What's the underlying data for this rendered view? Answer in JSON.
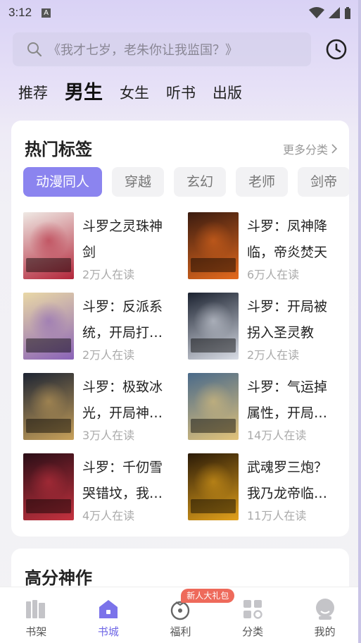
{
  "status_bar": {
    "time": "3:12",
    "app_badge": "A"
  },
  "search": {
    "placeholder": "《我才七岁，老朱你让我监国？》"
  },
  "channels": [
    {
      "label": "推荐",
      "active": false
    },
    {
      "label": "男生",
      "active": true
    },
    {
      "label": "女生",
      "active": false
    },
    {
      "label": "听书",
      "active": false
    },
    {
      "label": "出版",
      "active": false
    }
  ],
  "hot_tags": {
    "title": "热门标签",
    "more_label": "更多分类",
    "tags": [
      "动漫同人",
      "穿越",
      "玄幻",
      "老师",
      "剑帝"
    ],
    "active_tag": "动漫同人"
  },
  "books": [
    {
      "title": "斗罗之灵珠神剑",
      "readers": "2万人在读",
      "cover_colors": [
        "#efe9e4",
        "#b3263a"
      ]
    },
    {
      "title": "斗罗：凤神降临，帝炎焚天",
      "readers": "6万人在读",
      "cover_colors": [
        "#3a1b10",
        "#e56a1d"
      ]
    },
    {
      "title": "斗罗：反派系统，开局打…",
      "readers": "2万人在读",
      "cover_colors": [
        "#e9d8a6",
        "#8a63b8"
      ]
    },
    {
      "title": "斗罗：开局被拐入圣灵教",
      "readers": "2万人在读",
      "cover_colors": [
        "#1b2230",
        "#d9dde6"
      ]
    },
    {
      "title": "斗罗：极致冰光，开局神…",
      "readers": "3万人在读",
      "cover_colors": [
        "#1d2433",
        "#c8a15a"
      ]
    },
    {
      "title": "斗罗：气运掉属性，开局…",
      "readers": "14万人在读",
      "cover_colors": [
        "#4a6a8a",
        "#e2c37a"
      ]
    },
    {
      "title": "斗罗：千仞雪哭错坟，我…",
      "readers": "4万人在读",
      "cover_colors": [
        "#2a0e16",
        "#c5323f"
      ]
    },
    {
      "title": "武魂罗三炮？我乃龙帝临…",
      "readers": "11万人在读",
      "cover_colors": [
        "#2a1a08",
        "#e3a21b"
      ]
    }
  ],
  "section2": {
    "title": "高分神作"
  },
  "bottom_nav": {
    "items": [
      {
        "label": "书架",
        "icon": "bookshelf-icon",
        "active": false
      },
      {
        "label": "书城",
        "icon": "bookstore-icon",
        "active": true
      },
      {
        "label": "福利",
        "icon": "gift-icon",
        "active": false
      },
      {
        "label": "分类",
        "icon": "category-icon",
        "active": false
      },
      {
        "label": "我的",
        "icon": "profile-icon",
        "active": false
      }
    ],
    "welfare_badge": "新人大礼包"
  },
  "colors": {
    "accent": "#6f67e6",
    "tag_active": "#8b84ef",
    "badge": "#ee6a5b"
  }
}
